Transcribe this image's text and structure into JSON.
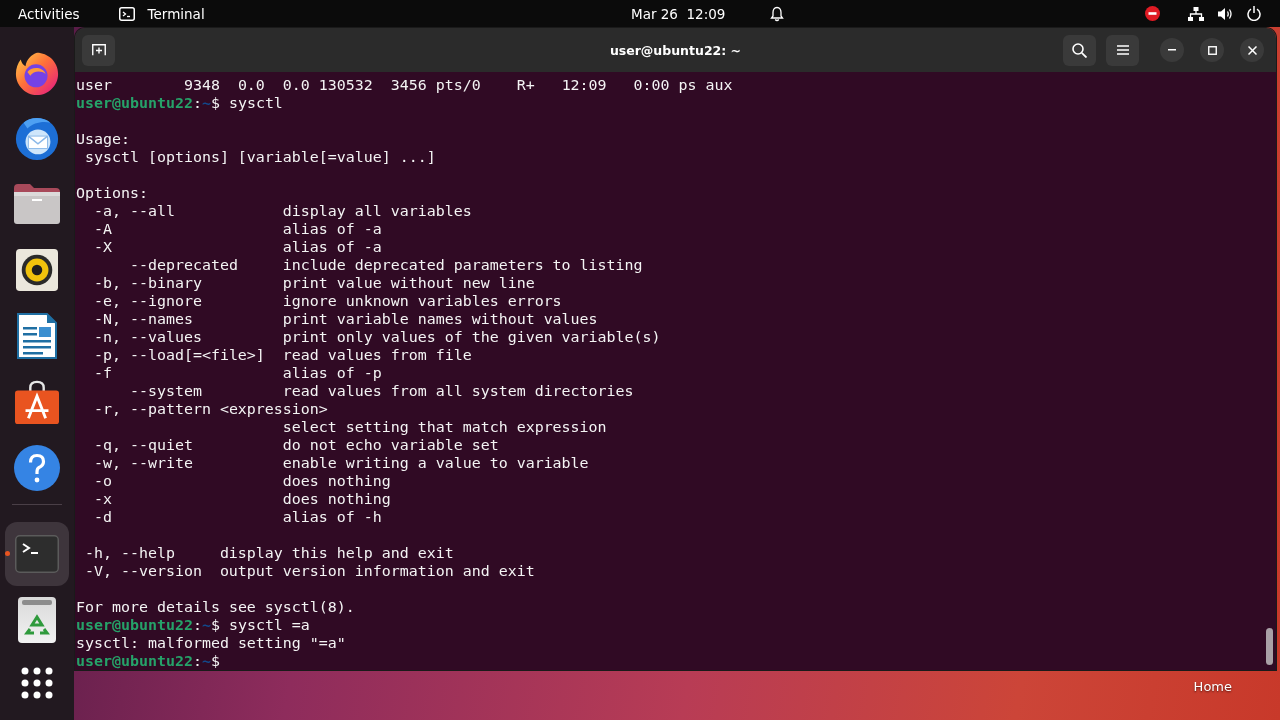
{
  "top_bar": {
    "activities": "Activities",
    "app_menu": "Terminal",
    "clock": "Mar 26  12:09"
  },
  "dock": {
    "favorites": [
      {
        "kind": "browser",
        "running": false,
        "selected": false
      },
      {
        "kind": "mail",
        "running": false,
        "selected": false
      },
      {
        "kind": "files",
        "running": false,
        "selected": false
      },
      {
        "kind": "music",
        "running": false,
        "selected": false
      },
      {
        "kind": "writer",
        "running": false,
        "selected": false
      },
      {
        "kind": "store",
        "running": false,
        "selected": false
      },
      {
        "kind": "help",
        "running": false,
        "selected": false
      }
    ],
    "others": [
      {
        "kind": "terminal",
        "running": true,
        "selected": true
      },
      {
        "kind": "trash",
        "running": false,
        "selected": false
      }
    ]
  },
  "window": {
    "title": "user@ubuntu22: ~"
  },
  "terminal": {
    "lines": [
      {
        "kind": "output",
        "text": "user        9348  0.0  0.0 130532  3456 pts/0    R+   12:09   0:00 ps aux"
      },
      {
        "kind": "prompt",
        "host": "user@ubuntu22",
        "sep": ":",
        "path": "~",
        "symbol": "$",
        "command": "sysctl"
      },
      {
        "kind": "blank"
      },
      {
        "kind": "output",
        "text": "Usage:"
      },
      {
        "kind": "usage",
        "text": "sysctl [options] [variable[=value] ...]"
      },
      {
        "kind": "blank"
      },
      {
        "kind": "output",
        "text": "Options:"
      },
      {
        "kind": "option",
        "flag": "-a, --all",
        "description": "display all variables"
      },
      {
        "kind": "option",
        "flag": "-A",
        "description": "alias of -a"
      },
      {
        "kind": "option",
        "flag": "-X",
        "description": "alias of -a"
      },
      {
        "kind": "long_option",
        "flag": "--deprecated",
        "description": "include deprecated parameters to listing"
      },
      {
        "kind": "option",
        "flag": "-b, --binary",
        "description": "print value without new line"
      },
      {
        "kind": "option",
        "flag": "-e, --ignore",
        "description": "ignore unknown variables errors"
      },
      {
        "kind": "option",
        "flag": "-N, --names",
        "description": "print variable names without values"
      },
      {
        "kind": "option",
        "flag": "-n, --values",
        "description": "print only values of the given variable(s)"
      },
      {
        "kind": "option",
        "flag": "-p, --load[=<file>]",
        "description": "read values from file"
      },
      {
        "kind": "option",
        "flag": "-f",
        "description": "alias of -p"
      },
      {
        "kind": "long_option",
        "flag": "--system",
        "description": "read values from all system directories"
      },
      {
        "kind": "option",
        "flag": "-r, --pattern <expression>"
      },
      {
        "kind": "option",
        "description": "select setting that match expression"
      },
      {
        "kind": "option",
        "flag": "-q, --quiet",
        "description": "do not echo variable set"
      },
      {
        "kind": "option",
        "flag": "-w, --write",
        "description": "enable writing a value to variable"
      },
      {
        "kind": "option",
        "flag": "-o",
        "description": "does nothing"
      },
      {
        "kind": "option",
        "flag": "-x",
        "description": "does nothing"
      },
      {
        "kind": "option",
        "flag": "-d",
        "description": "alias of -h"
      },
      {
        "kind": "blank"
      },
      {
        "kind": "help_option",
        "flag": "-h, --help",
        "description": "display this help and exit"
      },
      {
        "kind": "help_option",
        "flag": "-V, --version",
        "description": "output version information and exit"
      },
      {
        "kind": "blank"
      },
      {
        "kind": "output",
        "text": "For more details see sysctl(8)."
      },
      {
        "kind": "prompt",
        "host": "user@ubuntu22",
        "sep": ":",
        "path": "~",
        "symbol": "$",
        "command": "sysctl =a"
      },
      {
        "kind": "output",
        "text": "sysctl: malformed setting \"=a\""
      },
      {
        "kind": "prompt",
        "host": "user@ubuntu22",
        "sep": ":",
        "path": "~",
        "symbol": "$"
      }
    ]
  },
  "desktop": {
    "icons": [
      {
        "label": "Home"
      }
    ]
  }
}
